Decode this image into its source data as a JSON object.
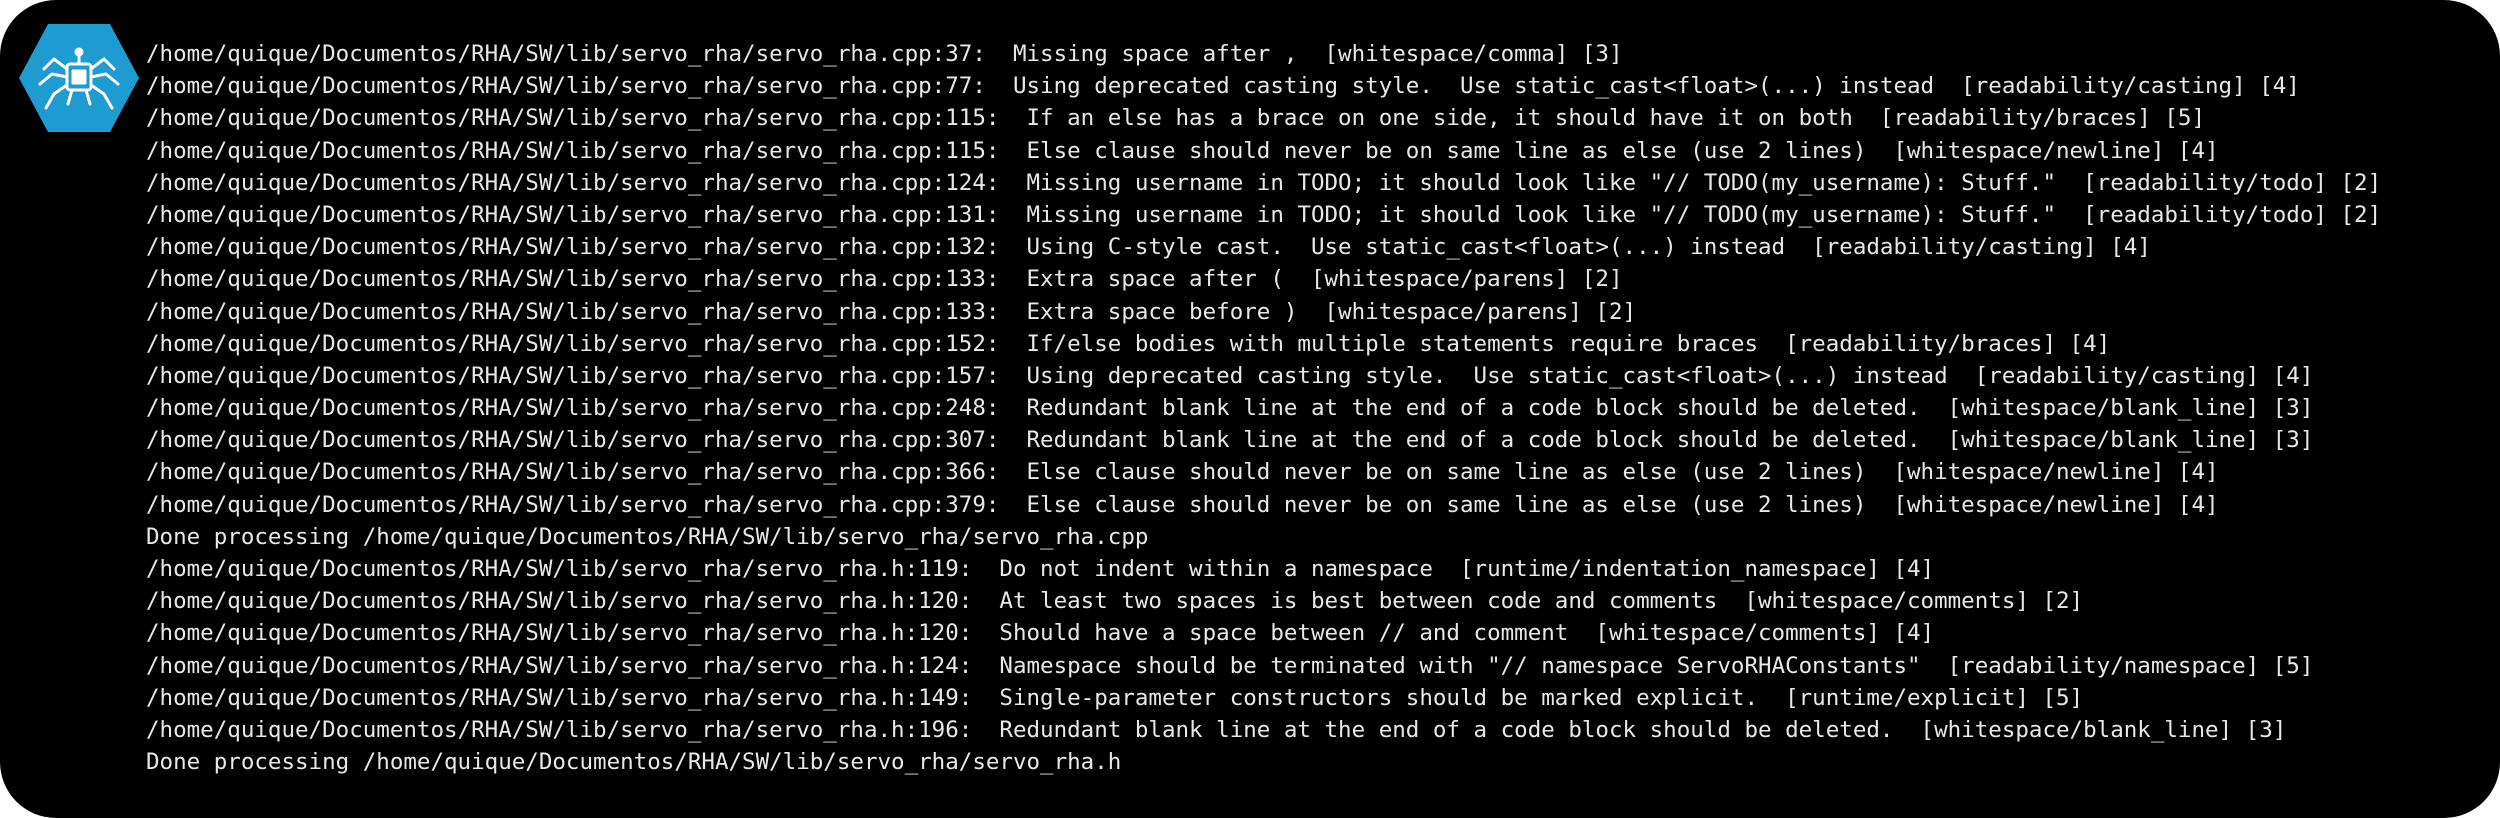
{
  "terminal": {
    "logo_icon": "robot-spider-logo-icon",
    "accent_color": "#1e9bd0",
    "lines": [
      "/home/quique/Documentos/RHA/SW/lib/servo_rha/servo_rha.cpp:37:  Missing space after ,  [whitespace/comma] [3]",
      "/home/quique/Documentos/RHA/SW/lib/servo_rha/servo_rha.cpp:77:  Using deprecated casting style.  Use static_cast<float>(...) instead  [readability/casting] [4]",
      "/home/quique/Documentos/RHA/SW/lib/servo_rha/servo_rha.cpp:115:  If an else has a brace on one side, it should have it on both  [readability/braces] [5]",
      "/home/quique/Documentos/RHA/SW/lib/servo_rha/servo_rha.cpp:115:  Else clause should never be on same line as else (use 2 lines)  [whitespace/newline] [4]",
      "/home/quique/Documentos/RHA/SW/lib/servo_rha/servo_rha.cpp:124:  Missing username in TODO; it should look like \"// TODO(my_username): Stuff.\"  [readability/todo] [2]",
      "/home/quique/Documentos/RHA/SW/lib/servo_rha/servo_rha.cpp:131:  Missing username in TODO; it should look like \"// TODO(my_username): Stuff.\"  [readability/todo] [2]",
      "/home/quique/Documentos/RHA/SW/lib/servo_rha/servo_rha.cpp:132:  Using C-style cast.  Use static_cast<float>(...) instead  [readability/casting] [4]",
      "/home/quique/Documentos/RHA/SW/lib/servo_rha/servo_rha.cpp:133:  Extra space after (  [whitespace/parens] [2]",
      "/home/quique/Documentos/RHA/SW/lib/servo_rha/servo_rha.cpp:133:  Extra space before )  [whitespace/parens] [2]",
      "/home/quique/Documentos/RHA/SW/lib/servo_rha/servo_rha.cpp:152:  If/else bodies with multiple statements require braces  [readability/braces] [4]",
      "/home/quique/Documentos/RHA/SW/lib/servo_rha/servo_rha.cpp:157:  Using deprecated casting style.  Use static_cast<float>(...) instead  [readability/casting] [4]",
      "/home/quique/Documentos/RHA/SW/lib/servo_rha/servo_rha.cpp:248:  Redundant blank line at the end of a code block should be deleted.  [whitespace/blank_line] [3]",
      "/home/quique/Documentos/RHA/SW/lib/servo_rha/servo_rha.cpp:307:  Redundant blank line at the end of a code block should be deleted.  [whitespace/blank_line] [3]",
      "/home/quique/Documentos/RHA/SW/lib/servo_rha/servo_rha.cpp:366:  Else clause should never be on same line as else (use 2 lines)  [whitespace/newline] [4]",
      "/home/quique/Documentos/RHA/SW/lib/servo_rha/servo_rha.cpp:379:  Else clause should never be on same line as else (use 2 lines)  [whitespace/newline] [4]",
      "Done processing /home/quique/Documentos/RHA/SW/lib/servo_rha/servo_rha.cpp",
      "/home/quique/Documentos/RHA/SW/lib/servo_rha/servo_rha.h:119:  Do not indent within a namespace  [runtime/indentation_namespace] [4]",
      "/home/quique/Documentos/RHA/SW/lib/servo_rha/servo_rha.h:120:  At least two spaces is best between code and comments  [whitespace/comments] [2]",
      "/home/quique/Documentos/RHA/SW/lib/servo_rha/servo_rha.h:120:  Should have a space between // and comment  [whitespace/comments] [4]",
      "/home/quique/Documentos/RHA/SW/lib/servo_rha/servo_rha.h:124:  Namespace should be terminated with \"// namespace ServoRHAConstants\"  [readability/namespace] [5]",
      "/home/quique/Documentos/RHA/SW/lib/servo_rha/servo_rha.h:149:  Single-parameter constructors should be marked explicit.  [runtime/explicit] [5]",
      "/home/quique/Documentos/RHA/SW/lib/servo_rha/servo_rha.h:196:  Redundant blank line at the end of a code block should be deleted.  [whitespace/blank_line] [3]",
      "Done processing /home/quique/Documentos/RHA/SW/lib/servo_rha/servo_rha.h"
    ]
  }
}
